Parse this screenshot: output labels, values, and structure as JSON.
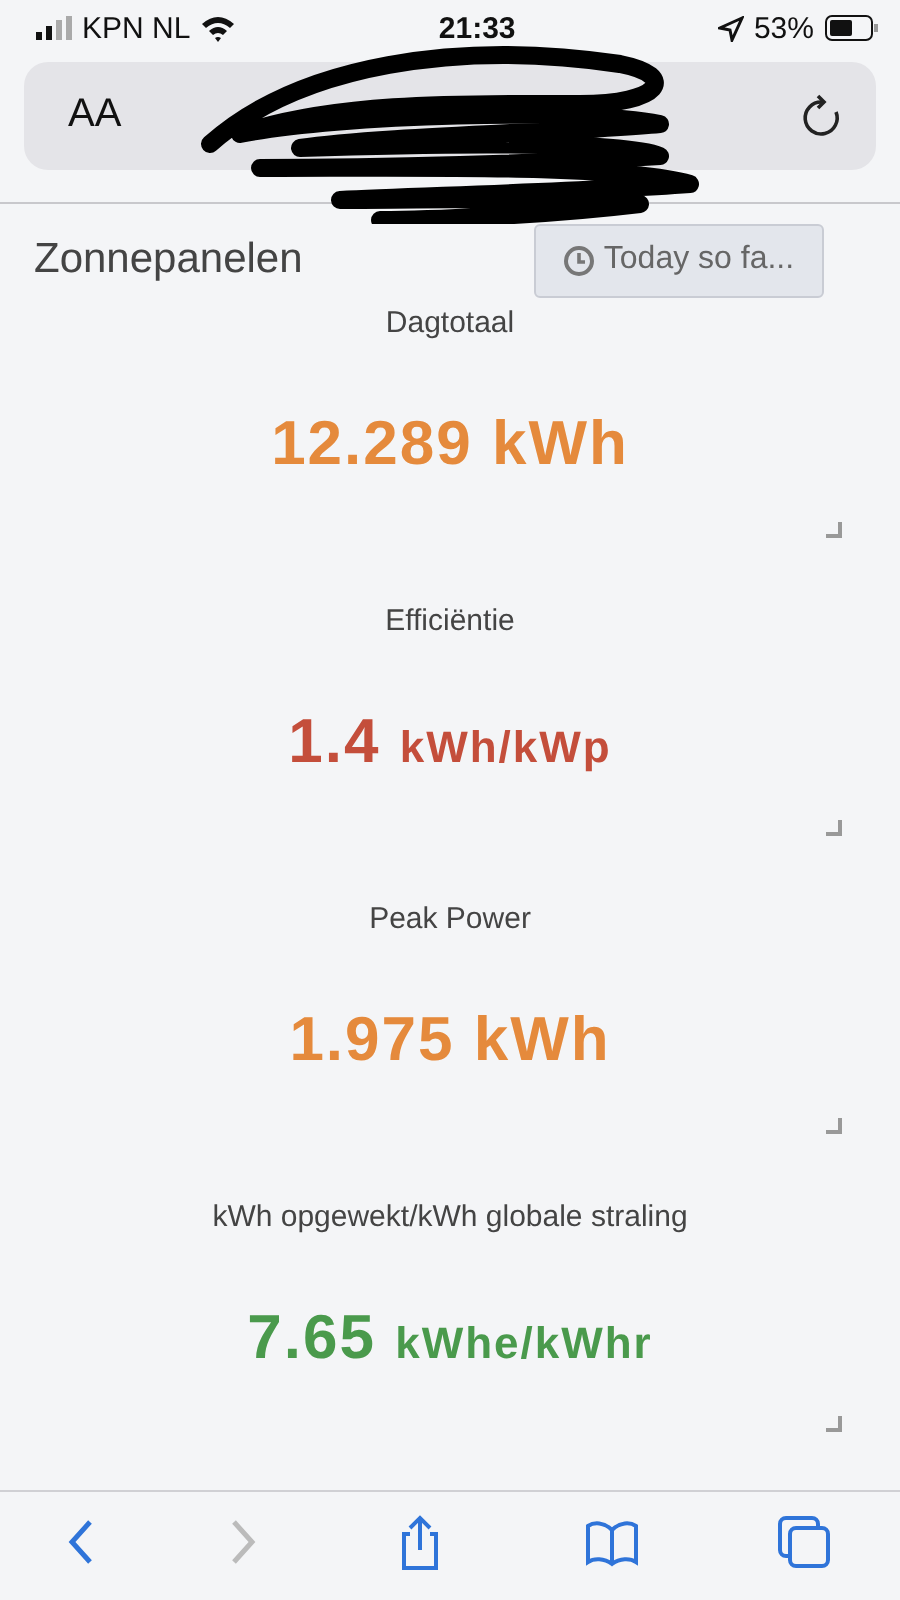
{
  "status_bar": {
    "carrier": "KPN NL",
    "time": "21:33",
    "battery": "53%"
  },
  "address_bar": {
    "text_size_button": "AA"
  },
  "header": {
    "title": "Zonnepanelen",
    "range_button": "Today so fa..."
  },
  "tiles": [
    {
      "label": "Dagtotaal",
      "kind": "plain",
      "value": "12.289 kWh",
      "color": "#e58a3c"
    },
    {
      "label": "Efficiëntie",
      "kind": "split",
      "value": "1.4",
      "unit": "kWh/kWp",
      "color": "#c44e3b"
    },
    {
      "label": "Peak Power",
      "kind": "plain",
      "value": "1.975 kWh",
      "color": "#e58a3c"
    },
    {
      "label": "kWh opgewekt/kWh globale straling",
      "kind": "split",
      "value": "7.65",
      "unit": "kWhe/kWhr",
      "color": "#4a9a4c"
    }
  ],
  "toolbar": [
    {
      "kind": "back",
      "disabled": false
    },
    {
      "kind": "forward",
      "disabled": true
    },
    {
      "kind": "share",
      "disabled": false
    },
    {
      "kind": "bookmarks",
      "disabled": false
    },
    {
      "kind": "tabs",
      "disabled": false
    }
  ]
}
